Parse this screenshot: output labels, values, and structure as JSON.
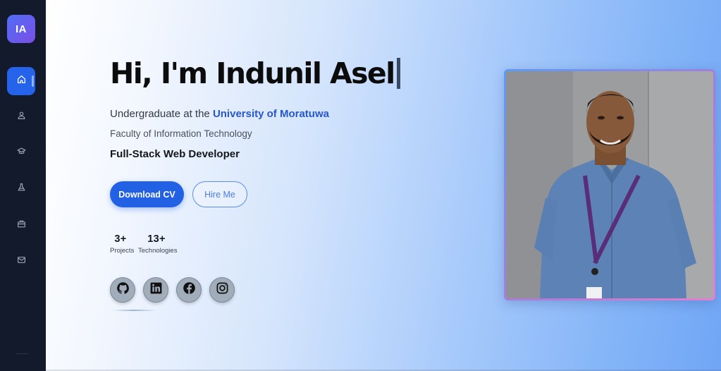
{
  "sidebar": {
    "logo": "IA",
    "nav": [
      {
        "name": "home",
        "icon": "home-icon",
        "active": true
      },
      {
        "name": "about",
        "icon": "user-icon",
        "active": false
      },
      {
        "name": "education",
        "icon": "graduation-cap-icon",
        "active": false
      },
      {
        "name": "projects",
        "icon": "flask-icon",
        "active": false
      },
      {
        "name": "portfolio",
        "icon": "briefcase-icon",
        "active": false
      },
      {
        "name": "contact",
        "icon": "mail-icon",
        "active": false
      }
    ]
  },
  "hero": {
    "headline": "Hi, I'm Indunil Asel",
    "line1_prefix": "Undergraduate at the ",
    "line1_link": "University of Moratuwa",
    "line2": "Faculty of Information Technology",
    "line3": "Full-Stack Web Developer",
    "primary_button": "Download CV",
    "secondary_button": "Hire Me",
    "stats": [
      {
        "value": "3+",
        "label": "Projects"
      },
      {
        "value": "13+",
        "label": "Technologies"
      }
    ],
    "socials": [
      "github-icon",
      "linkedin-icon",
      "facebook-icon",
      "instagram-icon"
    ]
  },
  "colors": {
    "sidebar_bg": "#131a2c",
    "accent": "#2260e4",
    "link": "#2757c9"
  }
}
